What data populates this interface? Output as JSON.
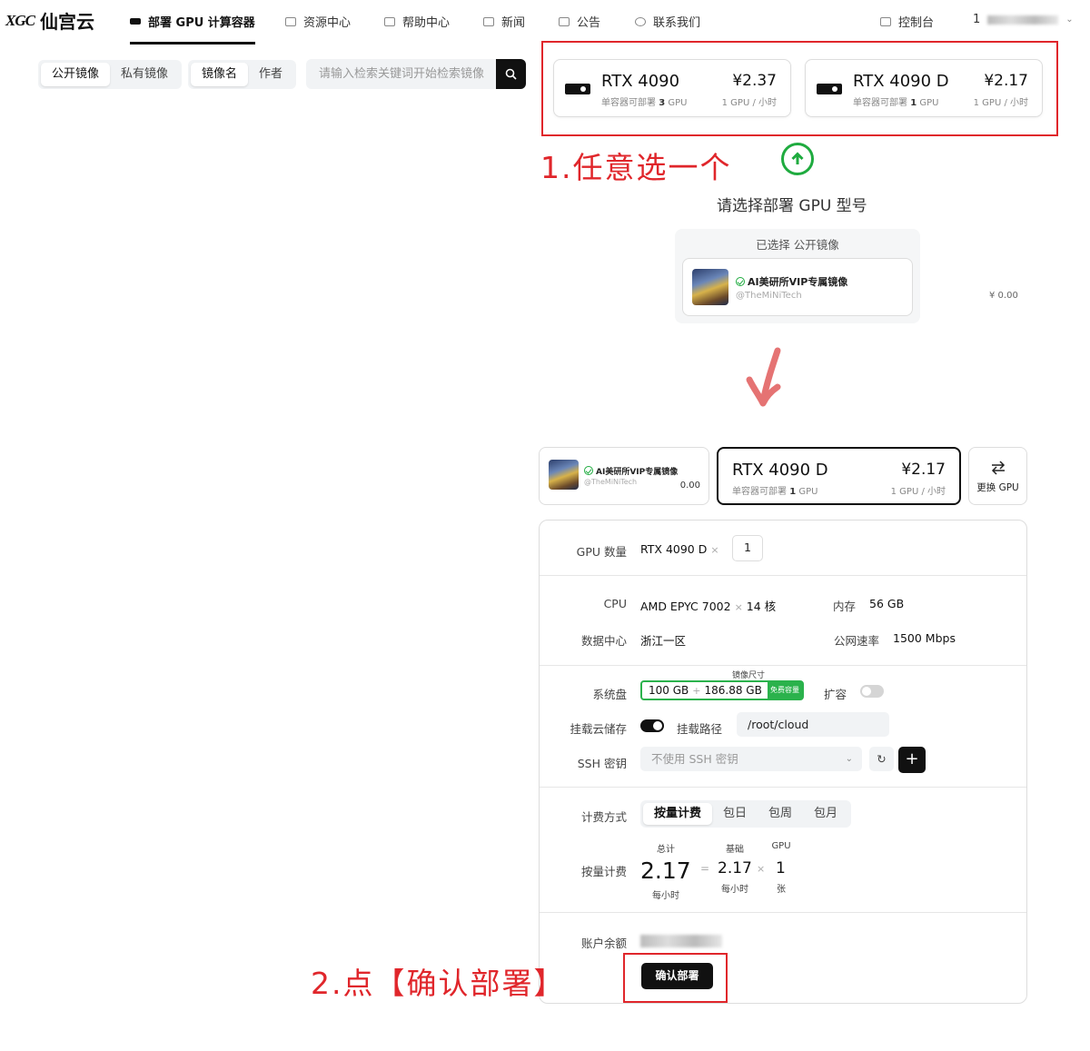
{
  "brand": {
    "mark": "XGC",
    "name": "仙宫云"
  },
  "nav": {
    "items": [
      {
        "label": "部署 GPU 计算容器"
      },
      {
        "label": "资源中心"
      },
      {
        "label": "帮助中心"
      },
      {
        "label": "新闻"
      },
      {
        "label": "公告"
      },
      {
        "label": "联系我们"
      }
    ],
    "console": "控制台",
    "user_prefix": "1"
  },
  "filters": {
    "source_tabs": [
      "公开镜像",
      "私有镜像"
    ],
    "search_by_tabs": [
      "镜像名",
      "作者"
    ],
    "search_placeholder": "请输入检索关键词开始检索镜像"
  },
  "gpu_options": [
    {
      "name": "RTX 4090",
      "sub_prefix": "单容器可部署",
      "count": "3",
      "sub_suffix": "GPU",
      "price": "¥2.37",
      "unit": "1 GPU / 小时"
    },
    {
      "name": "RTX 4090 D",
      "sub_prefix": "单容器可部署",
      "count": "1",
      "sub_suffix": "GPU",
      "price": "¥2.17",
      "unit": "1 GPU / 小时"
    }
  ],
  "annotations": {
    "step1": "1.任意选一个",
    "step2": "2.点【确认部署】"
  },
  "select_prompt": "请选择部署 GPU 型号",
  "selected_header": "已选择 公开镜像",
  "selected_image": {
    "name": "AI美研所VIP专属镜像",
    "author": "@TheMiNiTech",
    "price": "¥ 0.00",
    "price_short": "0.00"
  },
  "chosen_gpu": {
    "name": "RTX 4090 D",
    "sub_prefix": "单容器可部署",
    "count": "1",
    "sub_suffix": "GPU",
    "price": "¥2.17",
    "unit": "1 GPU / 小时"
  },
  "change_gpu": "更换 GPU",
  "config": {
    "gpu_count_label": "GPU 数量",
    "gpu_model": "RTX 4090 D",
    "gpu_count": "1",
    "cpu_label": "CPU",
    "cpu_model": "AMD EPYC 7002",
    "cpu_cores": "14 核",
    "mem_label": "内存",
    "mem_value": "56 GB",
    "dc_label": "数据中心",
    "dc_value": "浙江一区",
    "net_label": "公网速率",
    "net_value": "1500 Mbps",
    "disk_label": "系统盘",
    "disk_caption": "镜像尺寸",
    "disk_free": "100 GB",
    "disk_image": "186.88 GB",
    "disk_badge": "免费容量",
    "expand_label": "扩容",
    "expand_on": false,
    "mount_label": "挂载云储存",
    "mount_on": true,
    "mount_path_label": "挂载路径",
    "mount_path": "/root/cloud",
    "ssh_label": "SSH 密钥",
    "ssh_value": "不使用 SSH 密钥",
    "billing_label": "计费方式",
    "billing_tabs": [
      "按量计费",
      "包日",
      "包周",
      "包月"
    ],
    "billing_selected": "按量计费",
    "pay_label": "按量计费",
    "total_caption": "总计",
    "total_value": "2.17",
    "total_unit": "每小时",
    "base_caption": "基础",
    "base_value": "2.17",
    "base_unit": "每小时",
    "gpu_caption": "GPU",
    "gpu_value": "1",
    "gpu_unit": "张",
    "balance_label": "账户余额",
    "confirm": "确认部署"
  }
}
